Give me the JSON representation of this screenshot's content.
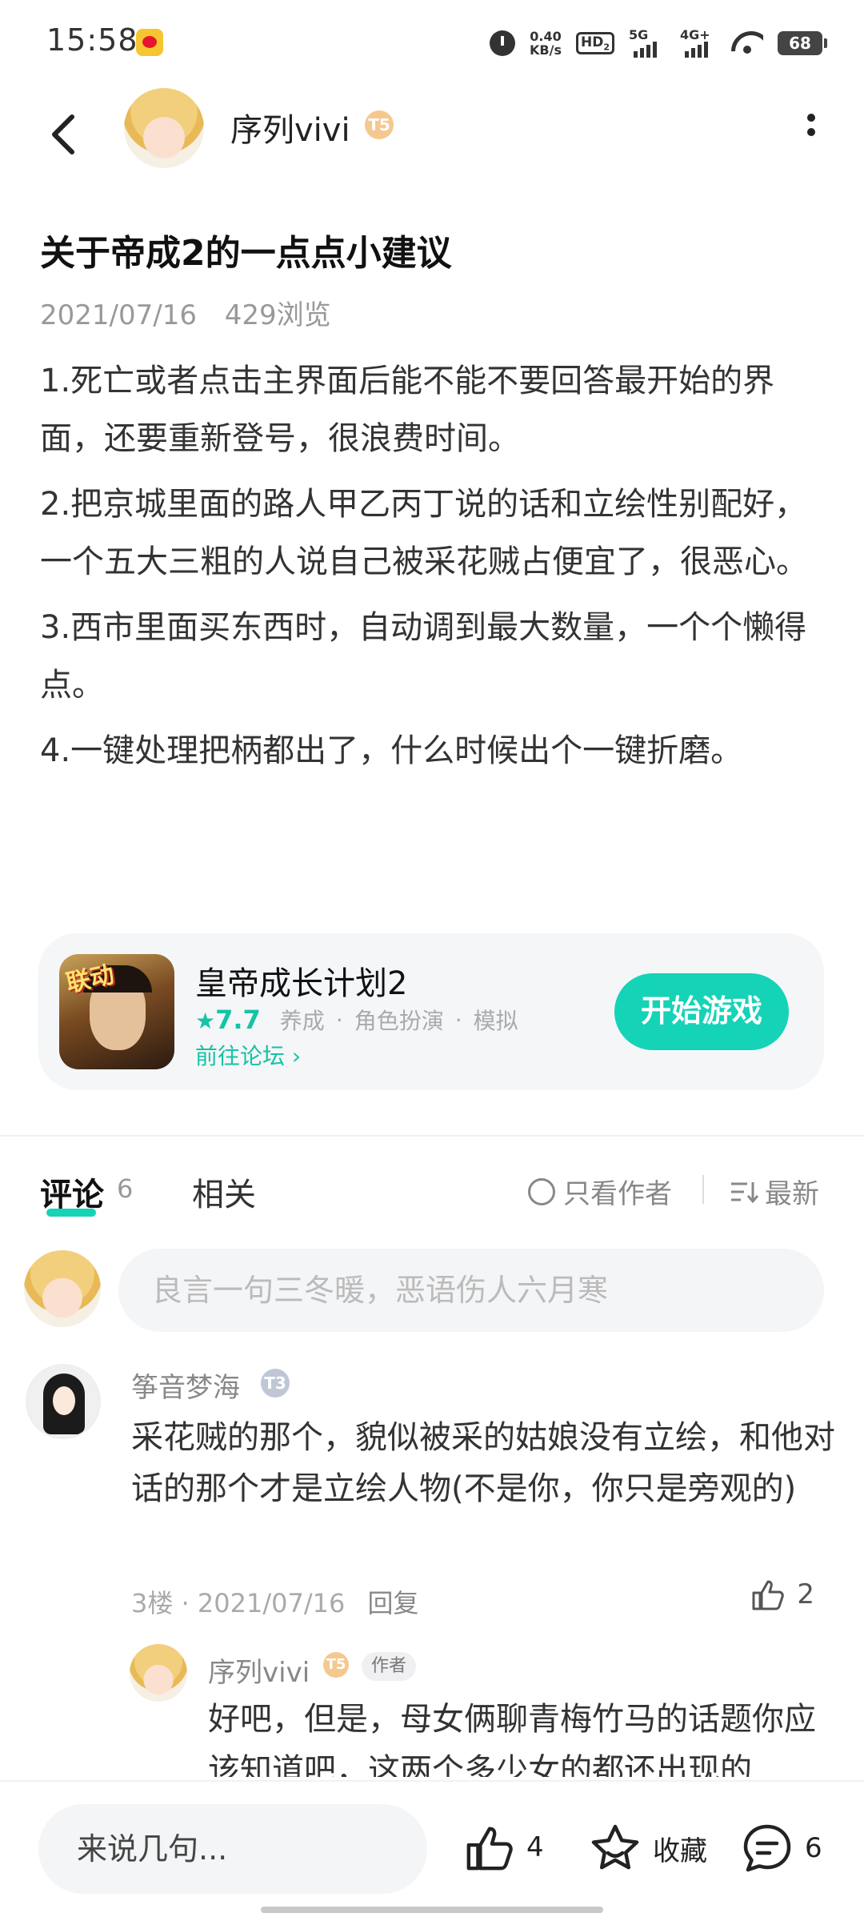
{
  "status_bar": {
    "time": "15:58",
    "net_speed_value": "0.40",
    "net_speed_unit": "KB/s",
    "hd_label": "HD",
    "hd_sub": "2",
    "signal1_label": "5G",
    "signal2_label": "4G+",
    "battery": "68"
  },
  "header": {
    "username": "序列vivi",
    "level_badge": "T5"
  },
  "post": {
    "title": "关于帝成2的一点点小建议",
    "date": "2021/07/16",
    "views": "429浏览",
    "paragraphs": [
      "1.死亡或者点击主界面后能不能不要回答最开始的界面，还要重新登号，很浪费时间。",
      "2.把京城里面的路人甲乙丙丁说的话和立绘性别配好，一个五大三粗的人说自己被采花贼占便宜了，很恶心。",
      "3.西市里面买东西时，自动调到最大数量，一个个懒得点。",
      "4.一键处理把柄都出了，什么时候出个一键折磨。"
    ]
  },
  "game_card": {
    "icon_text": "联动",
    "name": "皇帝成长计划2",
    "rating": "7.7",
    "tags": [
      "养成",
      "角色扮演",
      "模拟"
    ],
    "forum_link": "前往论坛",
    "start_label": "开始游戏",
    "accent_color": "#15d3b6"
  },
  "tabs": {
    "comments_label": "评论",
    "comments_count": "6",
    "related_label": "相关",
    "author_only_label": "只看作者",
    "sort_label": "最新"
  },
  "comment_input": {
    "placeholder": "良言一句三冬暖，恶语伤人六月寒"
  },
  "comments": [
    {
      "user": "筝音梦海",
      "level_badge": "T3",
      "text": "采花贼的那个，貌似被采的姑娘没有立绘，和他对话的那个才是立绘人物(不是你，你只是旁观的)",
      "floor": "3楼",
      "date": "2021/07/16",
      "reply_label": "回复",
      "likes": "2",
      "replies": [
        {
          "user": "序列vivi",
          "level_badge": "T5",
          "author_tag": "作者",
          "text": "好吧，但是，母女俩聊青梅竹马的话题你应该知道吧，这两个多少女的都还出现的"
        }
      ]
    }
  ],
  "bottom_bar": {
    "input_placeholder": "来说几句...",
    "like_count": "4",
    "favorite_label": "收藏",
    "comment_count": "6"
  }
}
